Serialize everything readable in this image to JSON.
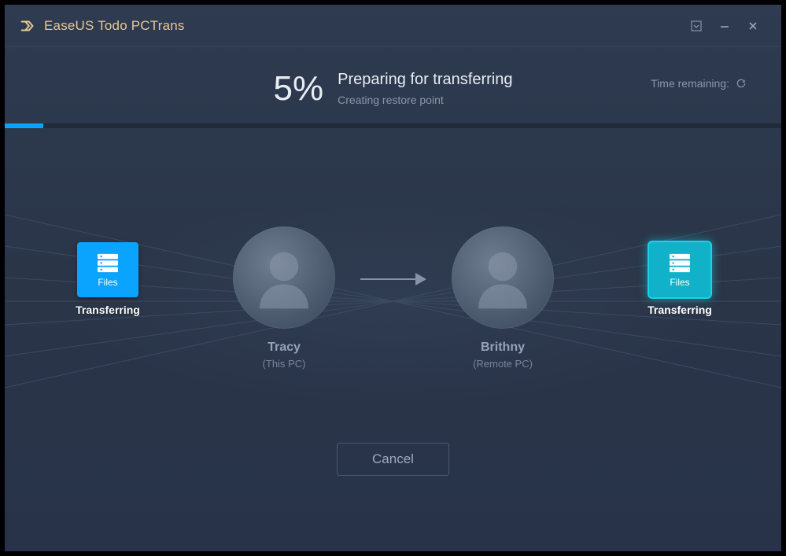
{
  "app": {
    "title": "EaseUS Todo PCTrans"
  },
  "progress": {
    "percent_label": "5%",
    "percent_value": 5,
    "title": "Preparing for transferring",
    "subtitle": "Creating restore point",
    "time_remaining_label": "Time remaining:"
  },
  "source_card": {
    "tile_label": "Files",
    "status": "Transferring"
  },
  "target_card": {
    "tile_label": "Files",
    "status": "Transferring"
  },
  "source_pc": {
    "name": "Tracy",
    "role": "(This PC)"
  },
  "target_pc": {
    "name": "Brithny",
    "role": "(Remote PC)"
  },
  "actions": {
    "cancel": "Cancel"
  }
}
